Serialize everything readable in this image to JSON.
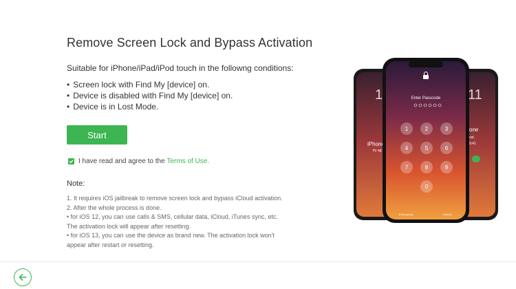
{
  "page": {
    "title": "Remove Screen Lock and Bypass Activation",
    "subtitle": "Suitable for iPhone/iPad/iPod touch in the followng conditions:",
    "conditions": [
      "Screen lock with Find My [device] on.",
      "Device is disabled with Find My [device] on.",
      "Device is in Lost Mode."
    ],
    "start_label": "Start",
    "agree_text": "I have read and agree to the ",
    "terms_link": "Terms of Use.",
    "note_title": "Note:",
    "notes": [
      "1. It requires iOS jailbreak to remove screen lock and bypass iCloud activation.",
      "2. After the whole process is done.",
      "•  for iOS 12, you can use calls & SMS, cellular data, iCloud, iTunes sync, etc.",
      "The activation lock will appear after resetting.",
      "•  for iOS 13, you can use the device as brand new. The activation lock won't",
      "appear after restart or resetting."
    ]
  },
  "phone": {
    "passcode_prompt": "Enter Passcode",
    "keys": [
      "1",
      "2",
      "3",
      "4",
      "5",
      "6",
      "7",
      "8",
      "9",
      "0"
    ],
    "emergency": "Emergency",
    "cancel": "Cancel",
    "left_phone": {
      "time": "11",
      "model": "iPhone",
      "sub": "try ag"
    },
    "right_phone": {
      "time": "11",
      "title": "one",
      "sub": "ost.",
      "time2": "9:41"
    }
  },
  "colors": {
    "accent": "#3db553"
  },
  "icons": {
    "back": "arrow-left-icon",
    "checkbox": "check-icon",
    "lock": "lock-icon"
  }
}
